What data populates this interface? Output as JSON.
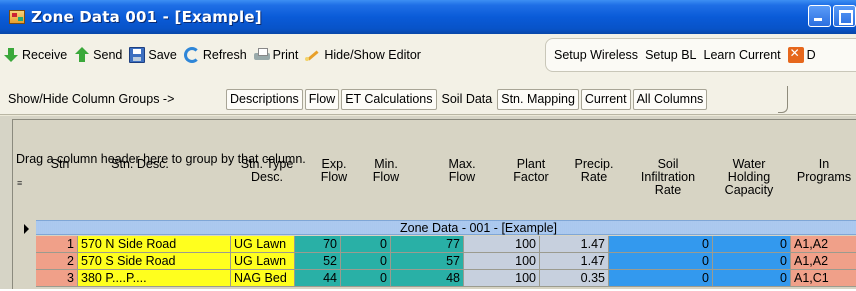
{
  "window": {
    "title": "Zone Data 001 - [Example]"
  },
  "toolbar": {
    "items": [
      {
        "label": "Receive",
        "icon": "receive-icon"
      },
      {
        "label": "Send",
        "icon": "send-icon"
      },
      {
        "label": "Save",
        "icon": "save-icon"
      },
      {
        "label": "Refresh",
        "icon": "refresh-icon"
      },
      {
        "label": "Print",
        "icon": "print-icon"
      },
      {
        "label": "Hide/Show Editor",
        "icon": "hide-show-editor-icon"
      }
    ],
    "setup_group": [
      {
        "label": "Setup Wireless"
      },
      {
        "label": "Setup BL"
      },
      {
        "label": "Learn Current"
      }
    ],
    "trailing": {
      "label": "D",
      "icon": "delete-icon"
    }
  },
  "column_groups": {
    "label": "Show/Hide Column Groups ->",
    "buttons": [
      {
        "label": "Descriptions",
        "boxed": true
      },
      {
        "label": "Flow",
        "boxed": true
      },
      {
        "label": "ET Calculations",
        "boxed": true
      },
      {
        "label": "Soil Data",
        "boxed": false
      },
      {
        "label": "Stn. Mapping",
        "boxed": true
      },
      {
        "label": "Current",
        "boxed": true
      },
      {
        "label": "All Columns",
        "boxed": true
      }
    ]
  },
  "grid": {
    "drag_hint": "Drag a column header here to group by that column.",
    "columns": [
      [
        "Stn"
      ],
      [
        "Stn. Desc."
      ],
      [
        "Stn. Type",
        "Desc."
      ],
      [
        "Exp.",
        "Flow"
      ],
      [
        "Min.",
        "Flow"
      ],
      [
        "Max.",
        "Flow"
      ],
      [
        "Plant",
        "Factor"
      ],
      [
        "Precip.",
        "Rate"
      ],
      [
        "Soil",
        "Infiltration",
        "Rate"
      ],
      [
        "Water",
        "Holding",
        "Capacity"
      ],
      [
        "In",
        "Programs"
      ]
    ],
    "group_row_label": "Zone Data - 001 - [Example]",
    "rows": [
      {
        "stn": "1",
        "desc": "570 N Side Road",
        "type": "UG Lawn",
        "exp": "70",
        "min": "0",
        "max": "77",
        "plant": "100",
        "precip": "1.47",
        "soil": "0",
        "water": "0",
        "programs": "A1,A2"
      },
      {
        "stn": "2",
        "desc": "570 S Side Road",
        "type": "UG Lawn",
        "exp": "52",
        "min": "0",
        "max": "57",
        "plant": "100",
        "precip": "1.47",
        "soil": "0",
        "water": "0",
        "programs": "A1,A2"
      },
      {
        "stn": "3",
        "desc": "380 P....P....",
        "type": "NAG Bed",
        "exp": "44",
        "min": "0",
        "max": "48",
        "plant": "100",
        "precip": "0.35",
        "soil": "0",
        "water": "0",
        "programs": "A1,C1"
      }
    ]
  },
  "colors": {
    "title_bar": "#0a5bd8",
    "stn_cell": "#f0a089",
    "desc_cell": "#ffff1e",
    "flow_cell": "#29b0a6",
    "et_cell": "#c7d0de",
    "soil_cell": "#3399ee"
  }
}
